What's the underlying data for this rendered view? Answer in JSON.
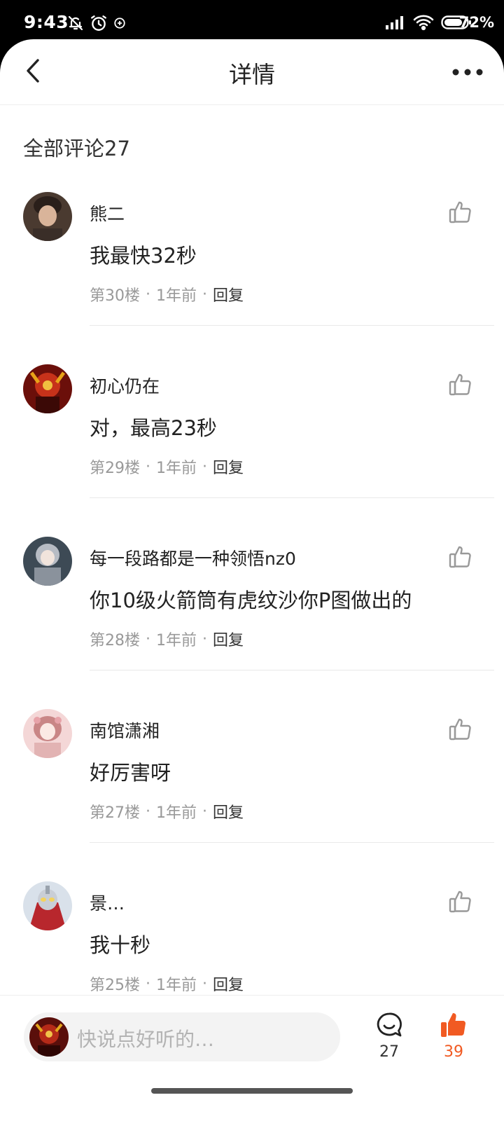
{
  "status": {
    "time": "9:43",
    "battery_pct": "72%",
    "icons": [
      "mute-bell-icon",
      "alarm-icon",
      "app-notification-icon",
      "signal-icon",
      "wifi-icon",
      "battery-icon"
    ]
  },
  "nav": {
    "title": "详情",
    "back_icon": "chevron-left-icon",
    "more_icon": "more-dots-icon"
  },
  "comments_header": "全部评论27",
  "comments": [
    {
      "name": "熊二",
      "text": "我最快32秒",
      "floor": "第30楼",
      "time": "1年前",
      "reply": "回复"
    },
    {
      "name": "初心仍在",
      "text": "对，最高23秒",
      "floor": "第29楼",
      "time": "1年前",
      "reply": "回复"
    },
    {
      "name": "每一段路都是一种领悟nz0",
      "text": "你10级火箭筒有虎纹沙你P图做出的",
      "floor": "第28楼",
      "time": "1年前",
      "reply": "回复"
    },
    {
      "name": "南馆潇湘",
      "text": "好厉害呀",
      "floor": "第27楼",
      "time": "1年前",
      "reply": "回复"
    },
    {
      "name": "景…",
      "text": "我十秒",
      "floor": "第25楼",
      "time": "1年前",
      "reply": "回复"
    }
  ],
  "meta_separator": "·",
  "bottom": {
    "placeholder": "快说点好听的…",
    "comment_count": "27",
    "like_count": "39"
  },
  "colors": {
    "accent": "#f15a22",
    "text_primary": "#222222",
    "text_secondary": "#999999"
  }
}
